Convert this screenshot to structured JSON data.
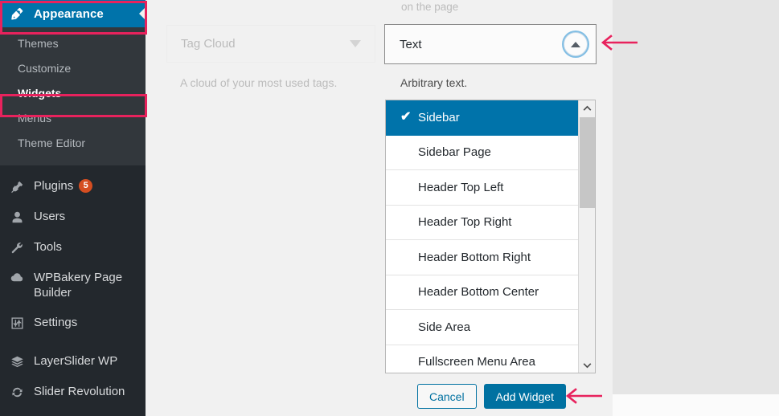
{
  "sidebar": {
    "current": {
      "label": "Appearance",
      "icon": "paintbrush-icon"
    },
    "submenu": [
      {
        "label": "Themes",
        "active": false
      },
      {
        "label": "Customize",
        "active": false
      },
      {
        "label": "Widgets",
        "active": true
      },
      {
        "label": "Menus",
        "active": false
      },
      {
        "label": "Theme Editor",
        "active": false
      }
    ],
    "items": [
      {
        "label": "Plugins",
        "icon": "plug-icon",
        "badge": "5"
      },
      {
        "label": "Users",
        "icon": "user-icon",
        "badge": ""
      },
      {
        "label": "Tools",
        "icon": "wrench-icon",
        "badge": ""
      },
      {
        "label": "WPBakery Page Builder",
        "icon": "cloud-icon",
        "badge": ""
      },
      {
        "label": "Settings",
        "icon": "sliders-icon",
        "badge": ""
      },
      {
        "label": "LayerSlider WP",
        "icon": "layers-icon",
        "badge": ""
      },
      {
        "label": "Slider Revolution",
        "icon": "refresh-icon",
        "badge": ""
      }
    ]
  },
  "left_widget": {
    "title": "Tag Cloud",
    "description": "A cloud of your most used tags.",
    "caret": "chevron-down-icon"
  },
  "partial_text": {
    "on_the_page": "on the page"
  },
  "text_widget": {
    "title": "Text",
    "description": "Arbitrary text.",
    "toggle_icon": "chevron-up-icon"
  },
  "sidebar_select": {
    "options": [
      {
        "label": "Sidebar",
        "selected": true
      },
      {
        "label": "Sidebar Page",
        "selected": false
      },
      {
        "label": "Header Top Left",
        "selected": false
      },
      {
        "label": "Header Top Right",
        "selected": false
      },
      {
        "label": "Header Bottom Right",
        "selected": false
      },
      {
        "label": "Header Bottom Center",
        "selected": false
      },
      {
        "label": "Side Area",
        "selected": false
      },
      {
        "label": "Fullscreen Menu Area",
        "selected": false
      }
    ],
    "checkmark": "✔",
    "scroll_up_icon": "chevron-up-icon",
    "scroll_down_icon": "chevron-down-icon"
  },
  "actions": {
    "cancel_label": "Cancel",
    "add_widget_label": "Add Widget"
  },
  "colors": {
    "accent_blue": "#0073aa",
    "button_blue": "#0071a1",
    "annotation_pink": "#e8225d",
    "badge_orange": "#d54e21",
    "sidebar_dark": "#23282d",
    "sidebar_submenu": "#32373c"
  }
}
